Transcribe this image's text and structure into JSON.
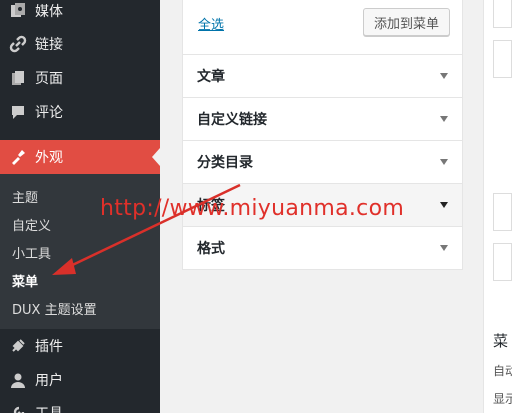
{
  "sidebar": {
    "items": [
      {
        "label": "媒体",
        "icon": "media-icon"
      },
      {
        "label": "链接",
        "icon": "link-icon"
      },
      {
        "label": "页面",
        "icon": "pages-icon"
      },
      {
        "label": "评论",
        "icon": "comments-icon"
      },
      {
        "label": "外观",
        "icon": "appearance-icon"
      },
      {
        "label": "插件",
        "icon": "plugins-icon"
      },
      {
        "label": "用户",
        "icon": "users-icon"
      },
      {
        "label": "工具",
        "icon": "tools-icon"
      }
    ],
    "submenu": [
      "主题",
      "自定义",
      "小工具",
      "菜单",
      "DUX 主题设置"
    ]
  },
  "panel": {
    "select_all": "全选",
    "add_button": "添加到菜单",
    "sections": [
      "文章",
      "自定义链接",
      "分类目录",
      "标签",
      "格式"
    ]
  },
  "right": {
    "heading": "菜",
    "line1": "自动",
    "line2": "显示"
  },
  "watermark": "http://www.miyuanma.com",
  "colors": {
    "sidebar_bg": "#23282d",
    "active_bg": "#e14d43",
    "link": "#0073aa",
    "watermark": "#e0302a"
  }
}
